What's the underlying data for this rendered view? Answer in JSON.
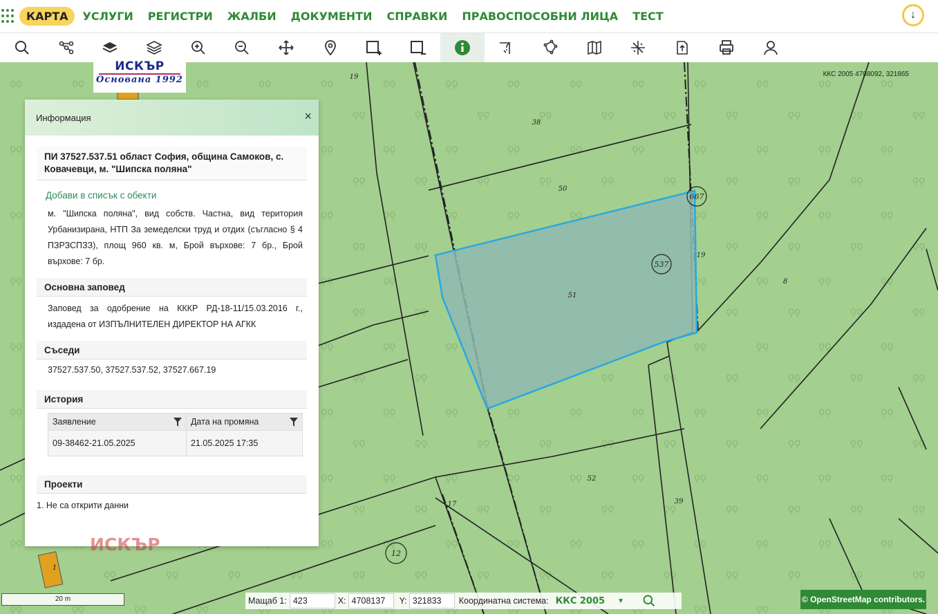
{
  "nav": {
    "items": [
      "КАРТА",
      "УСЛУГИ",
      "РЕГИСТРИ",
      "ЖАЛБИ",
      "ДОКУМЕНТИ",
      "СПРАВКИ",
      "ПРАВОСПОСОБНИ ЛИЦА",
      "ТЕСТ"
    ],
    "active_index": 0
  },
  "toolbar": {
    "tools": [
      "search-icon",
      "network-icon",
      "layers-filled-icon",
      "layers-icon",
      "zoom-in-icon",
      "zoom-out-icon",
      "pan-icon",
      "location-pin-icon",
      "add-rectangle-icon",
      "remove-rectangle-icon",
      "info-icon",
      "measure-icon",
      "polygon-icon",
      "map-icon",
      "crosshair-icon",
      "export-icon",
      "print-icon",
      "user-icon"
    ],
    "active": "info-icon"
  },
  "logo": {
    "name": "ИСКЪР",
    "subtitle": "Основана 1992"
  },
  "map": {
    "coord_label": "ККС 2005 4708092, 321865",
    "parcel_labels": [
      "19",
      "38",
      "50",
      "51",
      "52",
      "39",
      "8",
      "17",
      "1"
    ],
    "circle_labels": [
      "667",
      "537",
      "12"
    ],
    "colors": {
      "map_bg": "#a3cf8f",
      "parcel_fill": "#8fb9b0",
      "parcel_stroke": "#29a8e0",
      "accent": "#2f8a36"
    }
  },
  "panel": {
    "header": "Информация",
    "close": "×",
    "title": "ПИ 37527.537.51 област София, община Самоков, с. Ковачевци, м. \"Шипска поляна\"",
    "add_link": "Добави в списък с обекти",
    "description": "м. \"Шипска поляна\", вид собств. Частна, вид територия Урбанизирана, НТП За земеделски труд и отдих (съгласно § 4 ПЗРЗСПЗЗ), площ 960 кв. м, Брой върхове: 7 бр., Брой върхове: 7 бр.",
    "order_title": "Основна заповед",
    "order_text": "Заповед за одобрение на КККР РД-18-11/15.03.2016 г., издадена от ИЗПЪЛНИТЕЛЕН ДИРЕКТОР НА АГКК",
    "neighbors_title": "Съседи",
    "neighbors": "37527.537.50, 37527.537.52, 37527.667.19",
    "history_title": "История",
    "history_columns": [
      "Заявление",
      "Дата на промяна"
    ],
    "history_rows": [
      [
        "09-38462-21.05.2025",
        "21.05.2025 17:35"
      ]
    ],
    "projects_title": "Проекти",
    "projects_item": "1. Не са открити данни"
  },
  "watermark": "ИСКЪР",
  "status": {
    "scale_bar": "20 m",
    "scale_label": "Мащаб 1:",
    "scale_value": "423",
    "x_label": "X:",
    "x_value": "4708137",
    "y_label": "Y:",
    "y_value": "321833",
    "crs_label": "Координатна система:",
    "crs_value": "ККС 2005"
  },
  "osm": "© OpenStreetMap contributors."
}
